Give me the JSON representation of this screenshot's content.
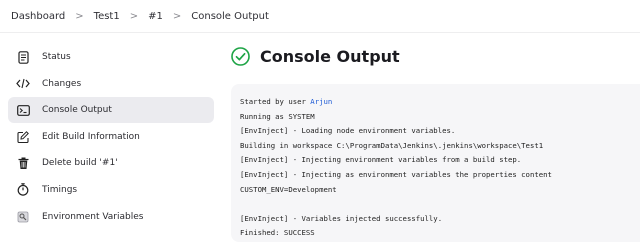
{
  "breadcrumb": {
    "items": [
      "Dashboard",
      "Test1",
      "#1",
      "Console Output"
    ],
    "separator": ">"
  },
  "sidebar": {
    "items": [
      {
        "label": "Status",
        "icon": "document-icon"
      },
      {
        "label": "Changes",
        "icon": "code-icon"
      },
      {
        "label": "Console Output",
        "icon": "terminal-icon",
        "active": true
      },
      {
        "label": "Edit Build Information",
        "icon": "edit-icon"
      },
      {
        "label": "Delete build '#1'",
        "icon": "trash-icon"
      },
      {
        "label": "Timings",
        "icon": "stopwatch-icon"
      },
      {
        "label": "Environment Variables",
        "icon": "env-vars-icon"
      }
    ]
  },
  "main": {
    "title": "Console Output",
    "status_icon": "success-check-icon",
    "status_color": "#1ea446"
  },
  "console": {
    "started_prefix": "Started by user ",
    "started_user": "Arjun",
    "lines": [
      "Running as SYSTEM",
      "[EnvInject] - Loading node environment variables.",
      "Building in workspace C:\\ProgramData\\Jenkins\\.jenkins\\workspace\\Test1",
      "[EnvInject] - Injecting environment variables from a build step.",
      "[EnvInject] - Injecting as environment variables the properties content",
      "CUSTOM_ENV=Development",
      "",
      "[EnvInject] - Variables injected successfully.",
      "Finished: SUCCESS"
    ]
  }
}
